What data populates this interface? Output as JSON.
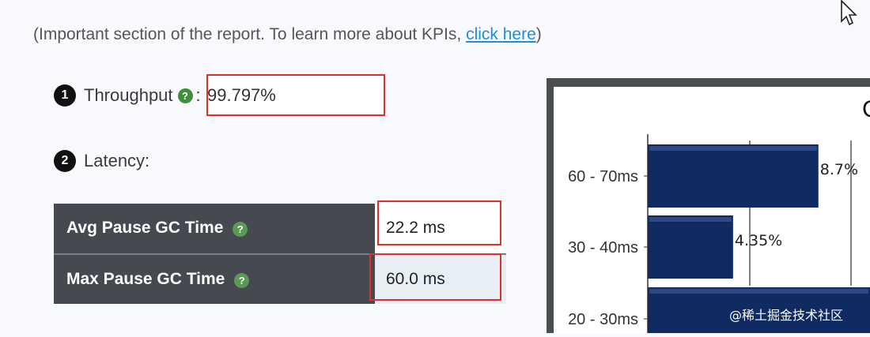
{
  "intro": {
    "text": "(Important section of the report. To learn more about KPIs, ",
    "link": "click here",
    "close": ")"
  },
  "throughput": {
    "number": "1",
    "label": "Throughput",
    "separator": ":",
    "value": "99.797%"
  },
  "latency": {
    "number": "2",
    "label": "Latency:",
    "rows": [
      {
        "label": "Avg Pause GC Time",
        "value": "22.2 ms"
      },
      {
        "label": "Max Pause GC Time",
        "value": "60.0 ms"
      }
    ]
  },
  "chart_data": {
    "type": "bar",
    "orientation": "horizontal",
    "title": "C",
    "categories": [
      "60 - 70ms",
      "30 - 40ms",
      "20 - 30ms"
    ],
    "values": [
      8.7,
      4.35,
      null
    ],
    "value_labels": [
      "8.7%",
      "4.35%",
      ""
    ],
    "bar_color": "#102a62",
    "grid": true
  },
  "watermark": "@稀土掘金技术社区",
  "colors": {
    "highlight": "#e0302c",
    "link": "#1d8fd8",
    "help": "#3f8f3a"
  },
  "icons": {
    "help": "question-circle-icon",
    "cursor": "mouse-pointer-icon"
  }
}
